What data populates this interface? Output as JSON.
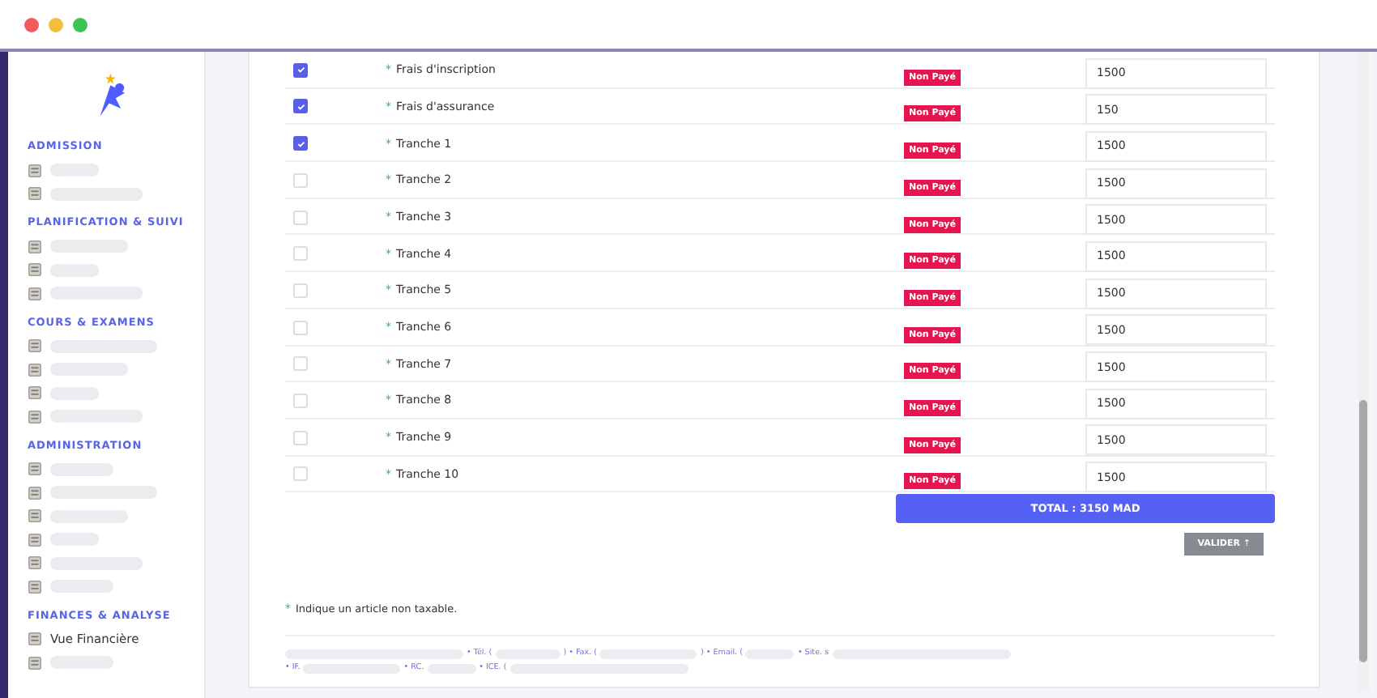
{
  "sidebar": {
    "sections": [
      {
        "title": "ADMISSION",
        "items": [
          {
            "kind": "redacted"
          },
          {
            "kind": "redacted"
          }
        ]
      },
      {
        "title": "PLANIFICATION & SUIVI",
        "items": [
          {
            "kind": "redacted"
          },
          {
            "kind": "redacted"
          },
          {
            "kind": "redacted"
          }
        ]
      },
      {
        "title": "COURS & EXAMENS",
        "items": [
          {
            "kind": "redacted"
          },
          {
            "kind": "redacted"
          },
          {
            "kind": "redacted"
          },
          {
            "kind": "redacted"
          }
        ]
      },
      {
        "title": "ADMINISTRATION",
        "items": [
          {
            "kind": "redacted"
          },
          {
            "kind": "redacted"
          },
          {
            "kind": "redacted"
          },
          {
            "kind": "redacted"
          },
          {
            "kind": "redacted"
          },
          {
            "kind": "redacted"
          }
        ]
      },
      {
        "title": "FINANCES & ANALYSE",
        "items": [
          {
            "kind": "link",
            "label": "Vue Financière"
          },
          {
            "kind": "redacted"
          }
        ]
      }
    ]
  },
  "rows": [
    {
      "label": "Frais d'inscription",
      "checked": true,
      "status": "Non Payé",
      "amount": "1500"
    },
    {
      "label": "Frais d'assurance",
      "checked": true,
      "status": "Non Payé",
      "amount": "150"
    },
    {
      "label": "Tranche 1",
      "checked": true,
      "status": "Non Payé",
      "amount": "1500"
    },
    {
      "label": "Tranche 2",
      "checked": false,
      "status": "Non Payé",
      "amount": "1500"
    },
    {
      "label": "Tranche 3",
      "checked": false,
      "status": "Non Payé",
      "amount": "1500"
    },
    {
      "label": "Tranche 4",
      "checked": false,
      "status": "Non Payé",
      "amount": "1500"
    },
    {
      "label": "Tranche 5",
      "checked": false,
      "status": "Non Payé",
      "amount": "1500"
    },
    {
      "label": "Tranche 6",
      "checked": false,
      "status": "Non Payé",
      "amount": "1500"
    },
    {
      "label": "Tranche 7",
      "checked": false,
      "status": "Non Payé",
      "amount": "1500"
    },
    {
      "label": "Tranche 8",
      "checked": false,
      "status": "Non Payé",
      "amount": "1500"
    },
    {
      "label": "Tranche 9",
      "checked": false,
      "status": "Non Payé",
      "amount": "1500"
    },
    {
      "label": "Tranche 10",
      "checked": false,
      "status": "Non Payé",
      "amount": "1500"
    }
  ],
  "row_marker": "*",
  "total": "TOTAL : 3150 MAD",
  "validate_button": "VALIDER ⇡",
  "note": {
    "marker": "*",
    "text": "Indique un article non taxable."
  },
  "footer": {
    "lines": [
      [
        {
          "kind": "redacted"
        },
        {
          "kind": "text",
          "label": "• Tél. ("
        },
        {
          "kind": "redacted"
        },
        {
          "kind": "text",
          "label": ") • Fax. ("
        },
        {
          "kind": "redacted"
        },
        {
          "kind": "text",
          "label": ") • Email. ("
        },
        {
          "kind": "redacted"
        },
        {
          "kind": "text",
          "label": "• Site. s"
        },
        {
          "kind": "redacted"
        }
      ],
      [
        {
          "kind": "text",
          "label": "• IF."
        },
        {
          "kind": "redacted"
        },
        {
          "kind": "text",
          "label": "• RC."
        },
        {
          "kind": "redacted"
        },
        {
          "kind": "text",
          "label": "• ICE. ("
        },
        {
          "kind": "redacted"
        }
      ]
    ]
  }
}
